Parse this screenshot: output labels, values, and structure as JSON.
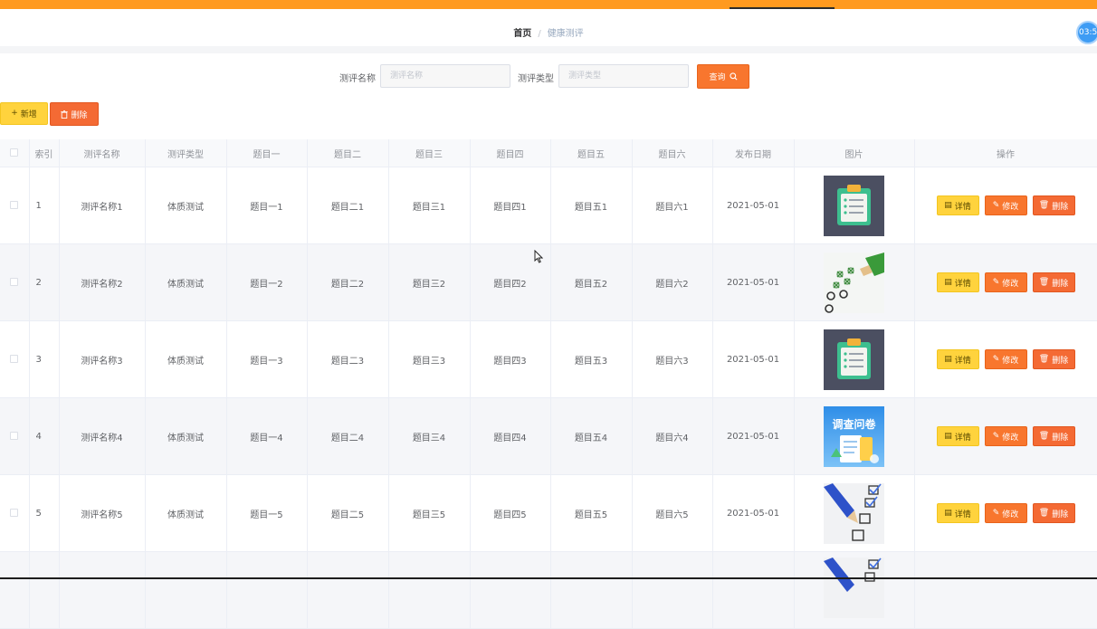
{
  "breadcrumb": {
    "home": "首页",
    "separator": "/",
    "current": "健康测评"
  },
  "clock": {
    "text": "03:5"
  },
  "search": {
    "name_label": "测评名称",
    "name_placeholder": "测评名称",
    "type_label": "测评类型",
    "type_placeholder": "测评类型",
    "query_label": "查询"
  },
  "toolbar": {
    "add_label": "新增",
    "delete_label": "删除"
  },
  "table": {
    "headers": [
      "索引",
      "测评名称",
      "测评类型",
      "题目一",
      "题目二",
      "题目三",
      "题目四",
      "题目五",
      "题目六",
      "发布日期",
      "图片",
      "操作"
    ],
    "rows": [
      {
        "index": "1",
        "name": "测评名称1",
        "type": "体质测试",
        "q1": "题目一1",
        "q2": "题目二1",
        "q3": "题目三1",
        "q4": "题目四1",
        "q5": "题目五1",
        "q6": "题目六1",
        "date": "2021-05-01",
        "image": "clipboard"
      },
      {
        "index": "2",
        "name": "测评名称2",
        "type": "体质测试",
        "q1": "题目一2",
        "q2": "题目二2",
        "q3": "题目三2",
        "q4": "题目四2",
        "q5": "题目五2",
        "q6": "题目六2",
        "date": "2021-05-01",
        "image": "checklist-pencil"
      },
      {
        "index": "3",
        "name": "测评名称3",
        "type": "体质测试",
        "q1": "题目一3",
        "q2": "题目二3",
        "q3": "题目三3",
        "q4": "题目四3",
        "q5": "题目五3",
        "q6": "题目六3",
        "date": "2021-05-01",
        "image": "clipboard"
      },
      {
        "index": "4",
        "name": "测评名称4",
        "type": "体质测试",
        "q1": "题目一4",
        "q2": "题目二4",
        "q3": "题目三4",
        "q4": "题目四4",
        "q5": "题目五4",
        "q6": "题目六4",
        "date": "2021-05-01",
        "image": "survey-banner",
        "image_text": "调查问卷"
      },
      {
        "index": "5",
        "name": "测评名称5",
        "type": "体质测试",
        "q1": "题目一5",
        "q2": "题目二5",
        "q3": "题目三5",
        "q4": "题目四5",
        "q5": "题目五5",
        "q6": "题目六5",
        "date": "2021-05-01",
        "image": "checkbox-pencil"
      }
    ],
    "actions": {
      "detail": "详情",
      "edit": "修改",
      "delete": "删除"
    }
  },
  "colors": {
    "accent": "#ff9a1f",
    "primary_button": "#f8762e",
    "danger": "#f46a34",
    "warning": "#ffd33d"
  }
}
